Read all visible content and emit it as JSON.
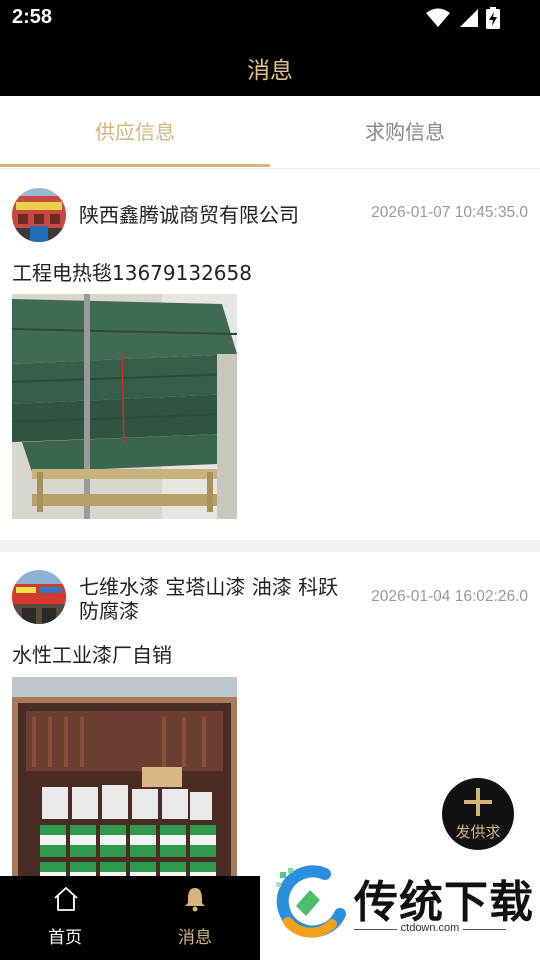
{
  "status_bar": {
    "time": "2:58"
  },
  "header": {
    "title": "消息"
  },
  "tabs": [
    {
      "label": "供应信息",
      "active": true
    },
    {
      "label": "求购信息",
      "active": false
    }
  ],
  "posts": [
    {
      "company": "陕西鑫腾诚商贸有限公司",
      "time": "2026-01-07 10:45:35.0",
      "body": "工程电热毯13679132658"
    },
    {
      "company": "七维水漆 宝塔山漆 油漆  科跃防腐漆",
      "time": "2026-01-04 16:02:26.0",
      "body": "水性工业漆厂自销"
    }
  ],
  "fab": {
    "label": "发供求",
    "icon": "plus-icon"
  },
  "bottom_nav": [
    {
      "label": "首页",
      "icon": "home-icon",
      "active": false
    },
    {
      "label": "消息",
      "icon": "bell-icon",
      "active": true
    }
  ],
  "watermark": {
    "text": "传统下载",
    "url": "ctdown.com"
  },
  "colors": {
    "accent": "#d6b47c",
    "header_bg": "#000000",
    "title": "#e3c38a"
  }
}
